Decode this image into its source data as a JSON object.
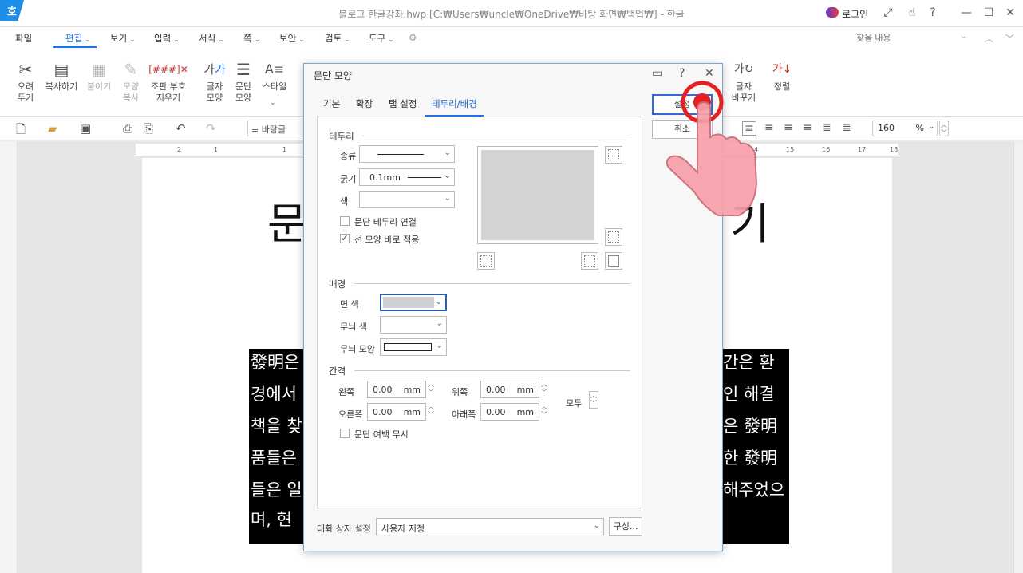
{
  "window": {
    "logo": "호",
    "title": "블로그 한글강좌.hwp [C:₩Users₩uncle₩OneDrive₩바탕 화면₩백업₩] - 한글",
    "login": "로그인"
  },
  "menu": {
    "items": [
      "파일",
      "편집",
      "보기",
      "입력",
      "서식",
      "쪽",
      "보안",
      "검토",
      "도구"
    ],
    "active": "편집",
    "search_placeholder": "찾을 내용"
  },
  "ribbon": {
    "buttons": [
      {
        "label": "오려\n두기",
        "icon": "scissors-icon"
      },
      {
        "label": "복사하기",
        "icon": "copy-icon"
      },
      {
        "label": "붙이기",
        "icon": "paste-icon",
        "disabled": true
      },
      {
        "label": "모양\n복사",
        "icon": "format-painter-icon",
        "disabled": true
      },
      {
        "label": "조판 부호\n지우기",
        "icon": "clear-codes-icon"
      },
      {
        "label": "글자\n모양",
        "icon": "char-shape-icon"
      },
      {
        "label": "문단\n모양",
        "icon": "para-shape-icon"
      },
      {
        "label": "스타일",
        "icon": "style-icon"
      },
      {
        "label": "글자\n바꾸기",
        "icon": "replace-icon"
      },
      {
        "label": "정렬",
        "icon": "sort-icon"
      }
    ]
  },
  "toolbar2": {
    "font": "바탕글",
    "zoom": "160",
    "zoom_unit": "%"
  },
  "ruler": {
    "ticks": [
      "2",
      "1",
      "1",
      "2",
      "3",
      "14",
      "15",
      "16",
      "17",
      "18"
    ]
  },
  "document": {
    "heading_left": "문",
    "heading_right": "기",
    "lines_left": [
      "發明은",
      "경에서",
      "책을 찾",
      "품들은",
      "들은 일",
      "며, 현"
    ],
    "lines_right": [
      "간은 환",
      "인 해결",
      "은 發明",
      "한 發明",
      "해주었으",
      ""
    ]
  },
  "dialog": {
    "title": "문단 모양",
    "tabs": [
      "기본",
      "확장",
      "탭 설정",
      "테두리/배경"
    ],
    "active_tab": "테두리/배경",
    "border": {
      "section": "테두리",
      "type_label": "종류",
      "width_label": "굵기",
      "width_value": "0.1mm",
      "color_label": "색",
      "connect_label": "문단 테두리 연결",
      "connect_checked": false,
      "apply_label": "선 모양 바로 적용",
      "apply_checked": true
    },
    "background": {
      "section": "배경",
      "face_label": "면 색",
      "pattern_color_label": "무늬 색",
      "pattern_shape_label": "무늬 모양"
    },
    "spacing": {
      "section": "간격",
      "left_label": "왼쪽",
      "right_label": "오른쪽",
      "top_label": "위쪽",
      "bottom_label": "아래쪽",
      "all_label": "모두",
      "left_value": "0.00",
      "right_value": "0.00",
      "top_value": "0.00",
      "bottom_value": "0.00",
      "unit": "mm",
      "ignore_margin_label": "문단 여백 무시",
      "ignore_checked": false
    },
    "footer": {
      "label": "대화 상자 설정",
      "preset": "사용자 지정",
      "config_button": "구성..."
    },
    "ok": "설정",
    "cancel": "취소"
  },
  "colors": {
    "accent": "#1a73e8",
    "preview_fill": "#d4d4d4",
    "face_color": "#d0d0d0",
    "highlight": "#e62020"
  }
}
